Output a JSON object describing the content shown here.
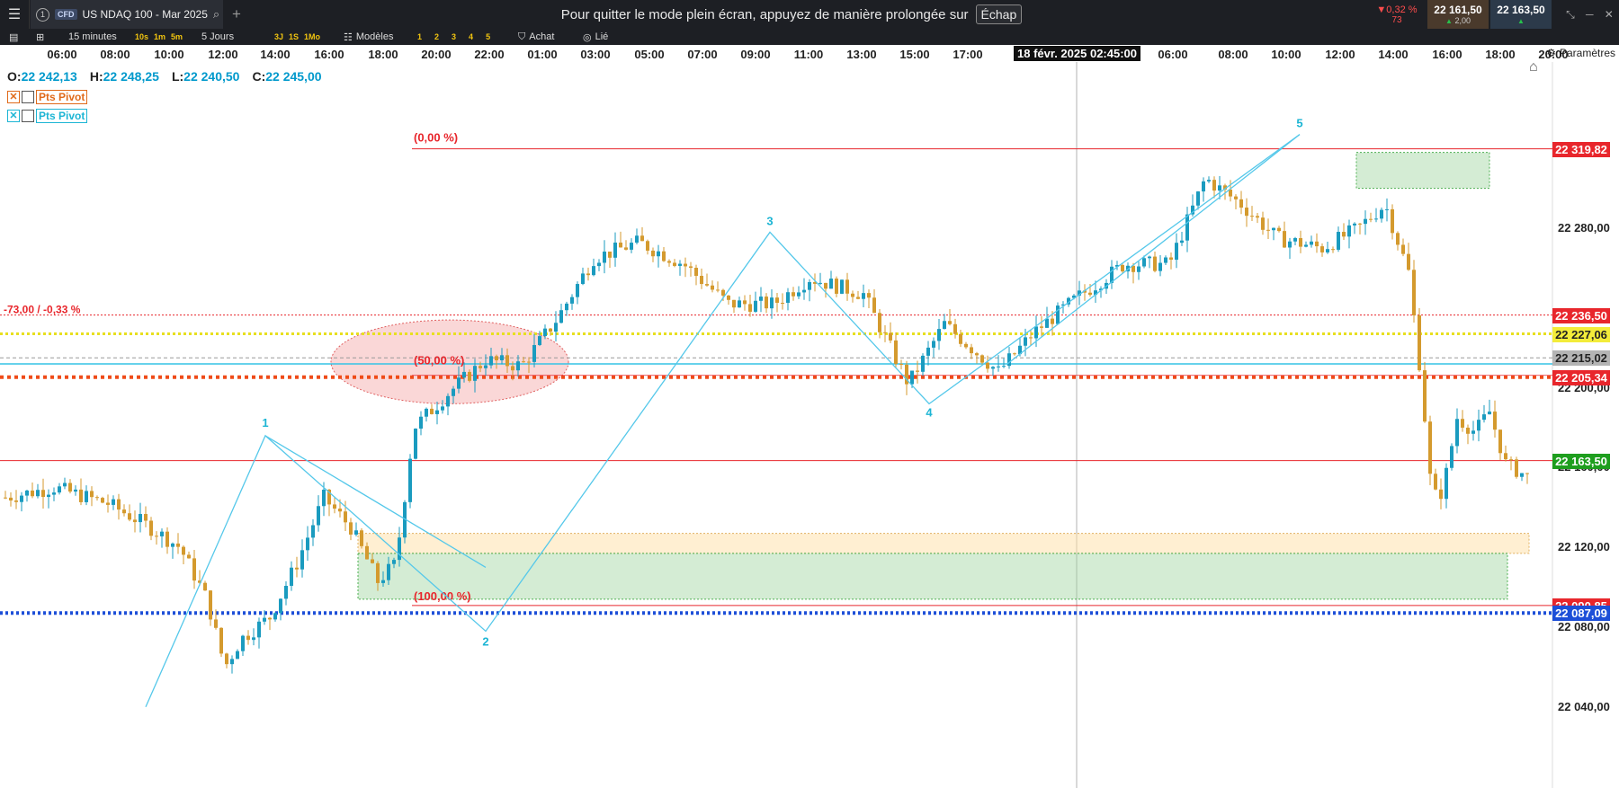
{
  "topbar": {
    "tab_number": "1",
    "badge": "CFD",
    "tab_title": "US NDAQ 100 - Mar 2025",
    "fullscreen_message": "Pour quitter le mode plein écran, appuyez de manière prolongée sur",
    "fullscreen_key": "Échap",
    "change_pct": "▼0,32 %",
    "change_pts": "73",
    "bid": "22 161,50",
    "ask": "22 163,50",
    "spread": "2,00"
  },
  "toolbar": {
    "interval": "15 minutes",
    "intervals": [
      "10s",
      "1m",
      "5m"
    ],
    "range": "5 Jours",
    "ranges": [
      "3J",
      "1S",
      "1Mo"
    ],
    "models": "Modèles",
    "slots": [
      "1",
      "2",
      "3",
      "4",
      "5"
    ],
    "buy": "Achat",
    "link": "Lié",
    "settings": "Paramètres"
  },
  "ohlc": {
    "o_label": "O:",
    "o": "22 242,13",
    "h_label": "H:",
    "h": "22 248,25",
    "l_label": "L:",
    "l": "22 240,50",
    "c_label": "C:",
    "c": "22 245,00"
  },
  "legends": [
    {
      "name": "Pts Pivot",
      "color": "#e06a1a"
    },
    {
      "name": "Pts Pivot",
      "color": "#1cb5d4"
    }
  ],
  "time_labels": [
    "06:00",
    "08:00",
    "10:00",
    "12:00",
    "14:00",
    "16:00",
    "18:00",
    "20:00",
    "22:00",
    "01:00",
    "03:00",
    "05:00",
    "07:00",
    "09:00",
    "11:00",
    "13:00",
    "15:00",
    "17:00",
    "06:00",
    "08:00",
    "10:00",
    "12:00",
    "14:00",
    "16:00",
    "18:00",
    "20:00"
  ],
  "cursor_time": "18 févr. 2025 02:45:00",
  "price_axis_labels": [
    "22 280,00",
    "22 200,00",
    "22 160,00",
    "22 120,00",
    "22 080,00",
    "22 040,00"
  ],
  "price_tags": [
    {
      "value": "22 319,82",
      "bg": "#e8262c",
      "fg": "#ffffff"
    },
    {
      "value": "22 236,50",
      "bg": "#e8262c",
      "fg": "#ffffff"
    },
    {
      "value": "22 227,06",
      "bg": "#f3ec3a",
      "fg": "#222222"
    },
    {
      "value": "22 215,02",
      "bg": "#b4b4b4",
      "fg": "#222222"
    },
    {
      "value": "22 205,34",
      "bg": "#e8262c",
      "fg": "#ffffff"
    },
    {
      "value": "22 163,50",
      "bg": "#1e9e1e",
      "fg": "#ffffff"
    },
    {
      "value": "22 090,85",
      "bg": "#e8262c",
      "fg": "#ffffff"
    },
    {
      "value": "22 087,09",
      "bg": "#1d4fd8",
      "fg": "#ffffff"
    }
  ],
  "annotations": {
    "fib_0": "(0,00 %)",
    "fib_50": "(50,00 %)",
    "fib_100": "(100,00 %)",
    "change_label": "-73,00 / -0,33 %",
    "waves": [
      "1",
      "2",
      "3",
      "4",
      "5"
    ]
  },
  "chart_data": {
    "type": "candlestick",
    "instrument": "US NDAQ 100 - Mar 2025",
    "interval": "15 minutes",
    "ylim": [
      22020,
      22335
    ],
    "levels": {
      "fib_0": 22319.82,
      "fib_100": 22090.85,
      "red_dotted": 22236.5,
      "yellow_dotted": 22227.06,
      "grey_dashed": 22215.02,
      "cyan_pivot": 22212,
      "orange_dotted": 22205.34,
      "last_price": 22163.5,
      "blue_dotted": 22087.09
    },
    "wave_points": [
      {
        "label": "1",
        "price": 22176
      },
      {
        "label": "2",
        "price": 22078
      },
      {
        "label": "3",
        "price": 22278
      },
      {
        "label": "4",
        "price": 22192
      },
      {
        "label": "5",
        "price": 22327
      }
    ]
  },
  "colors": {
    "bull": "#1a9bbf",
    "bear": "#d49a2e",
    "wave": "#55c8ea",
    "fib": "#e8262c",
    "zone_green": "#9fd49f",
    "zone_orange": "#ffdfa6",
    "ellipse": "#f28c8c"
  }
}
